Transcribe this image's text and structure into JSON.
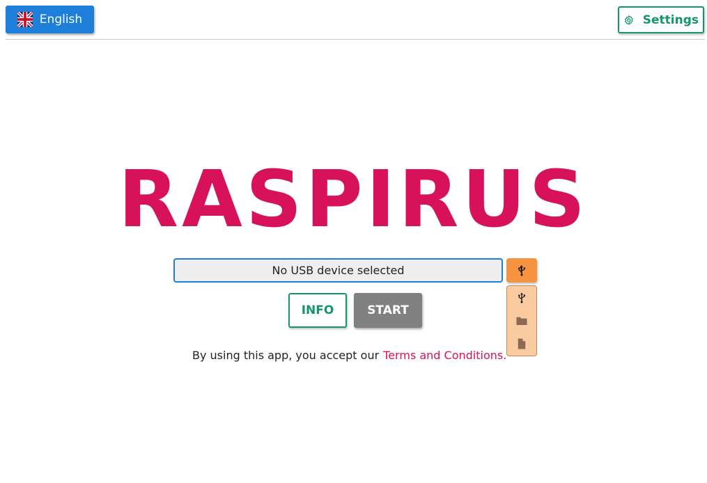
{
  "header": {
    "language_label": "English",
    "settings_label": "Settings"
  },
  "title": "RASPIRUS",
  "device": {
    "field_text": "No USB device selected"
  },
  "dropdown": {
    "items": [
      "usb-icon",
      "folder-icon",
      "file-icon"
    ]
  },
  "actions": {
    "info_label": "INFO",
    "start_label": "START"
  },
  "terms": {
    "text": "By using this app, you accept our",
    "link_text": "Terms and Conditions."
  },
  "colors": {
    "primary_blue": "#1d7fd9",
    "accent_green": "#16946c",
    "brand_pink": "#d8115b",
    "usb_orange": "#f59340",
    "dropdown_bg": "#fbcba0",
    "start_gray": "#808080"
  }
}
